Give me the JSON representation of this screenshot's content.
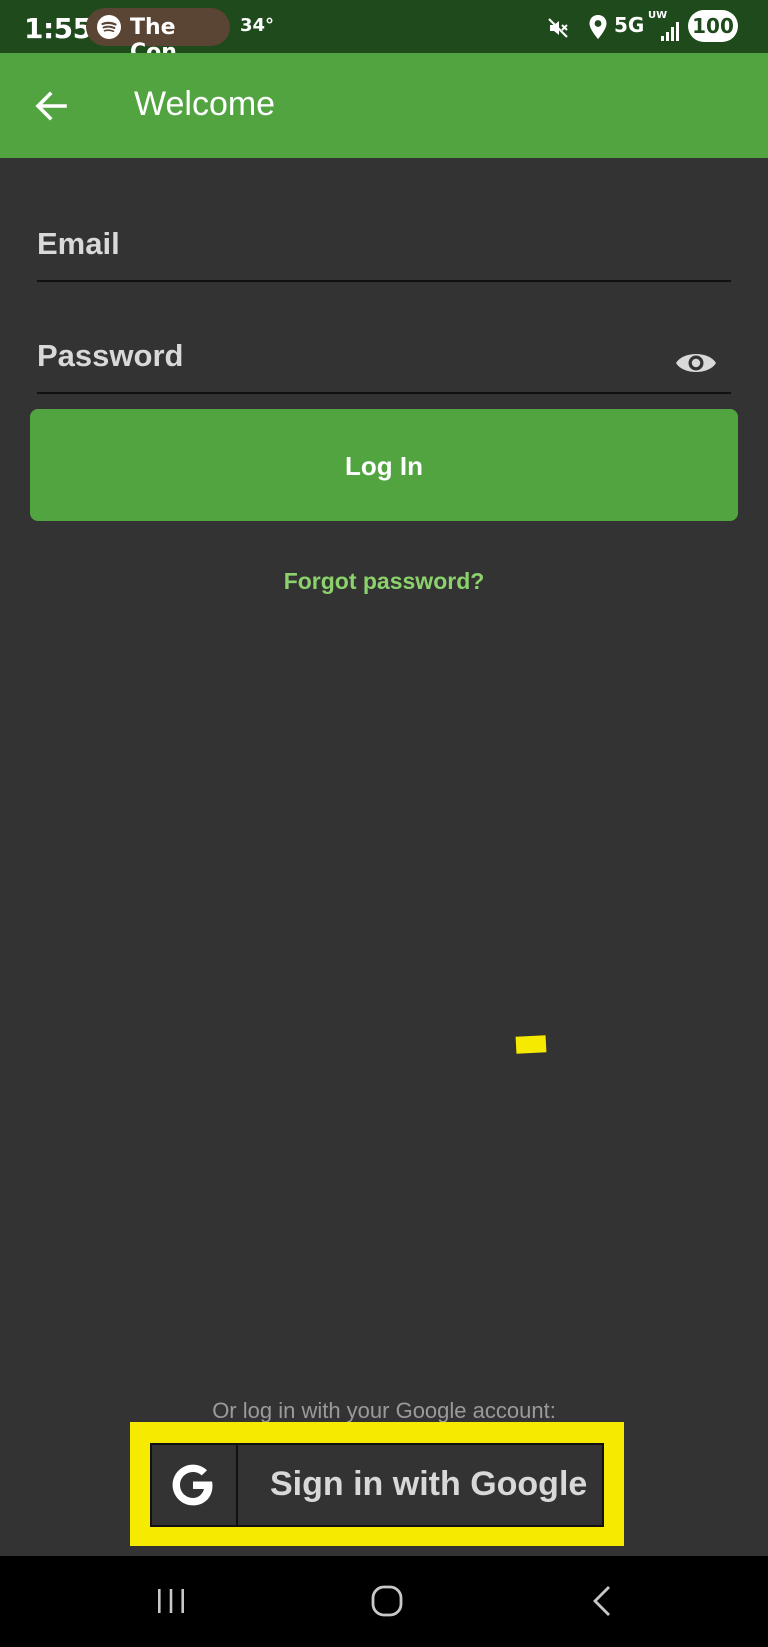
{
  "status_bar": {
    "time": "1:55",
    "media_label": "The Con",
    "temperature": "34°",
    "network": "5G",
    "network_sub": "UW",
    "battery": "100"
  },
  "app_bar": {
    "back_icon": "arrow-left-icon",
    "title": "Welcome"
  },
  "form": {
    "email_placeholder": "Email",
    "password_placeholder": "Password",
    "login_label": "Log In",
    "forgot_label": "Forgot password?"
  },
  "google": {
    "prompt": "Or log in with your Google account:",
    "button_label": "Sign in with Google"
  },
  "colors": {
    "accent": "#52a440",
    "status_bar": "#1f4a1c",
    "background": "#333333",
    "link": "#8bd16c",
    "highlight": "#f6ea00"
  }
}
